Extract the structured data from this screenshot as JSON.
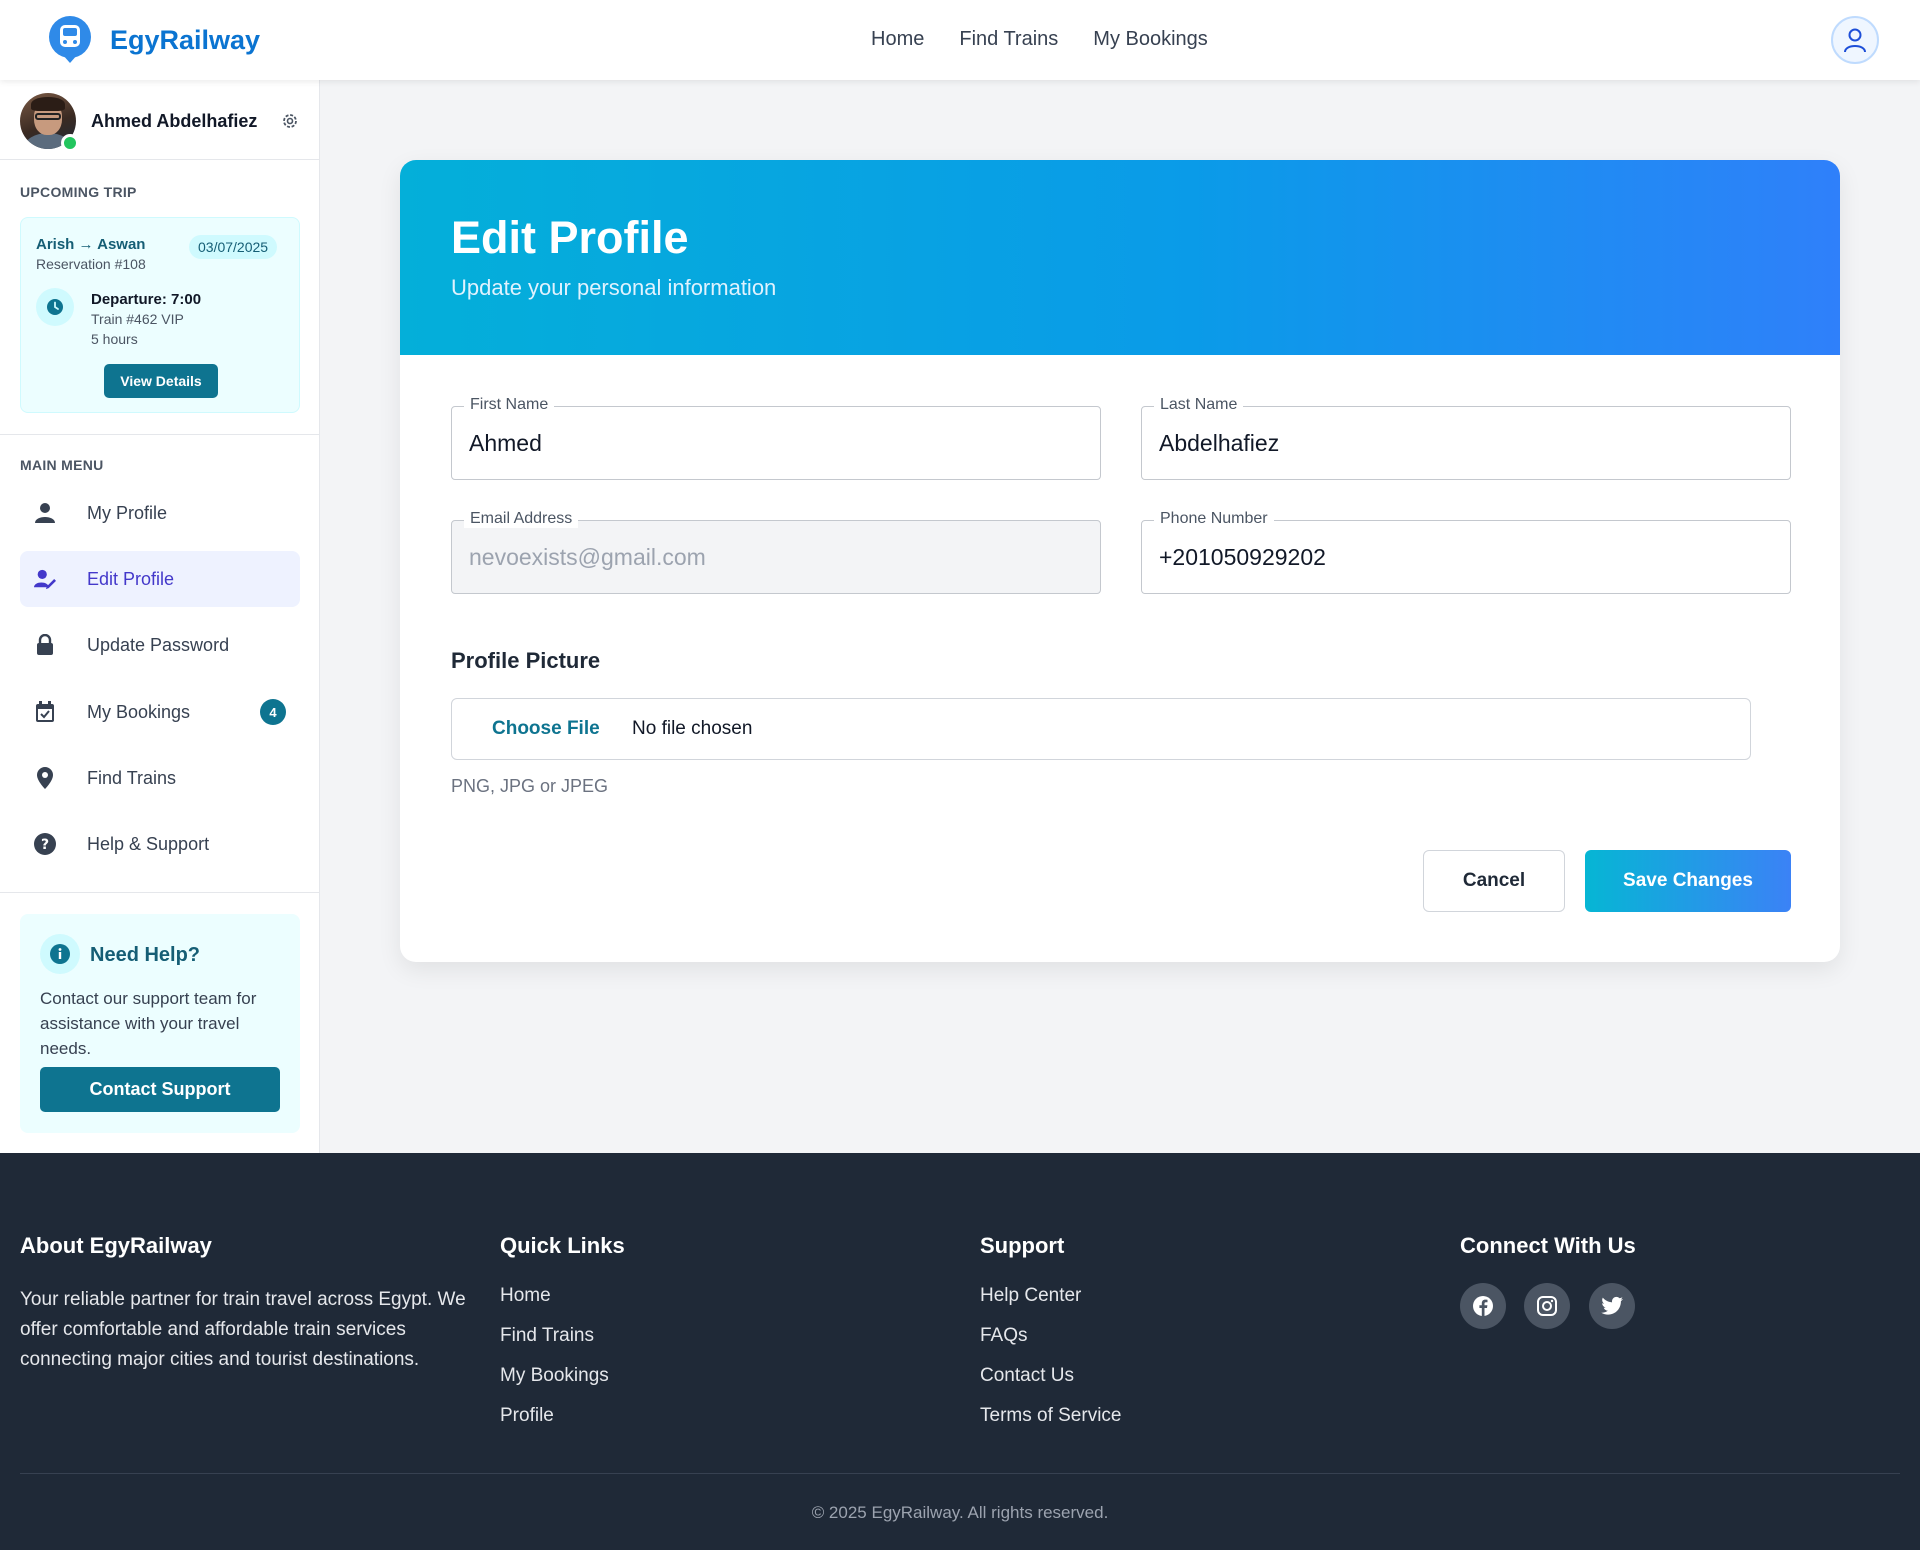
{
  "header": {
    "brand": "EgyRailway",
    "nav": [
      {
        "label": "Home"
      },
      {
        "label": "Find Trains"
      },
      {
        "label": "My Bookings"
      }
    ]
  },
  "sidebar": {
    "user_name": "Ahmed Abdelhafiez",
    "upcoming_label": "UPCOMING TRIP",
    "trip": {
      "route": "Arish → Aswan",
      "reservation": "Reservation #108",
      "date": "03/07/2025",
      "departure": "Departure: 7:00",
      "train": "Train #462 VIP",
      "duration": "5 hours",
      "view_button": "View Details"
    },
    "menu_label": "MAIN MENU",
    "menu": [
      {
        "label": "My Profile",
        "icon": "user-icon"
      },
      {
        "label": "Edit Profile",
        "icon": "user-edit-icon",
        "active": true
      },
      {
        "label": "Update Password",
        "icon": "lock-icon"
      },
      {
        "label": "My Bookings",
        "icon": "calendar-check-icon",
        "badge": "4"
      },
      {
        "label": "Find Trains",
        "icon": "map-pin-icon"
      },
      {
        "label": "Help & Support",
        "icon": "question-circle-icon"
      }
    ],
    "help": {
      "title": "Need Help?",
      "text": "Contact our support team for assistance with your travel needs.",
      "button": "Contact Support"
    }
  },
  "main": {
    "title": "Edit Profile",
    "subtitle": "Update your personal information",
    "fields": {
      "first_name": {
        "label": "First Name",
        "value": "Ahmed"
      },
      "last_name": {
        "label": "Last Name",
        "value": "Abdelhafiez"
      },
      "email": {
        "label": "Email Address",
        "value": "nevoexists@gmail.com",
        "disabled": true
      },
      "phone": {
        "label": "Phone Number",
        "value": "+201050929202"
      }
    },
    "picture": {
      "title": "Profile Picture",
      "choose": "Choose File",
      "status": "No file chosen",
      "hint": "PNG, JPG or JPEG"
    },
    "cancel": "Cancel",
    "save": "Save Changes"
  },
  "footer": {
    "about": {
      "title": "About EgyRailway",
      "text": "Your reliable partner for train travel across Egypt. We offer comfortable and affordable train services connecting major cities and tourist destinations."
    },
    "quick": {
      "title": "Quick Links",
      "links": [
        "Home",
        "Find Trains",
        "My Bookings",
        "Profile"
      ]
    },
    "support": {
      "title": "Support",
      "links": [
        "Help Center",
        "FAQs",
        "Contact Us",
        "Terms of Service"
      ]
    },
    "connect": {
      "title": "Connect With Us",
      "icons": [
        "facebook-icon",
        "instagram-icon",
        "twitter-icon"
      ]
    },
    "copyright": "© 2025 EgyRailway. All rights reserved."
  },
  "colors": {
    "brand": "#0b74d1",
    "accent": "#0e7490",
    "active_menu": "#4338ca",
    "footer_bg": "#1f2937"
  }
}
